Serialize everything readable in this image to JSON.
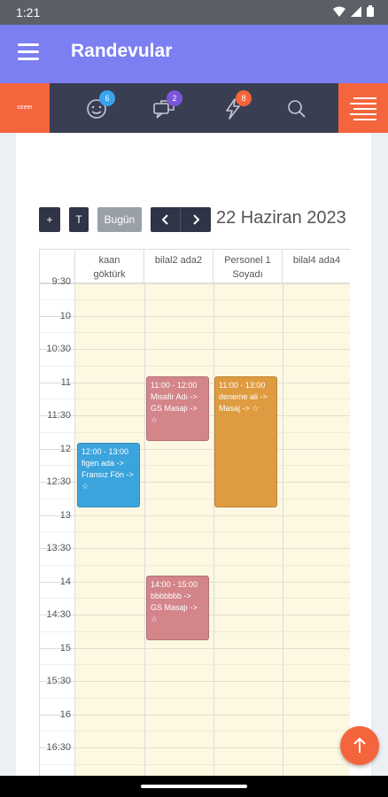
{
  "status_bar": {
    "time": "1:21"
  },
  "app_bar": {
    "title": "Randevular"
  },
  "toolbar": {
    "logo_text": "ozeer",
    "badges": {
      "customers": "6",
      "messages": "2",
      "notifications": "8"
    }
  },
  "controls": {
    "add": "+",
    "today_short": "T",
    "today": "Bugün",
    "date_title": "22 Haziran 2023"
  },
  "columns": [
    {
      "line1": "kaan",
      "line2": "göktürk"
    },
    {
      "line1": "bilal2 ada2",
      "line2": ""
    },
    {
      "line1": "Personel 1",
      "line2": "Soyadı"
    },
    {
      "line1": "bilal4 ada4",
      "line2": ""
    }
  ],
  "times": [
    "9:30",
    "10",
    "10:30",
    "11",
    "11:30",
    "12",
    "12:30",
    "13",
    "13:30",
    "14",
    "14:30",
    "15",
    "15:30",
    "16",
    "16:30"
  ],
  "events": [
    {
      "time": "12:00 - 13:00",
      "text": "figen ada -> Fransız Fön -> ☆",
      "color": "#3ba4dd"
    },
    {
      "time": "11:00 - 12:00",
      "text": "Misafir Adı -> GS Masajı -> ☆",
      "color": "#d3858a"
    },
    {
      "time": "14:00 - 15:00",
      "text": "bbbbbbb -> GS Masajı -> ☆",
      "color": "#d3858a"
    },
    {
      "time": "11:00 - 13:00",
      "text": "deneme ali -> Masaj -> ☆",
      "color": "#de9b3f"
    }
  ],
  "colors": {
    "accent": "#f5653d",
    "appbar": "#7b7ff2",
    "toolbar": "#3a3e52",
    "slot_bg": "#fcf8e1"
  }
}
